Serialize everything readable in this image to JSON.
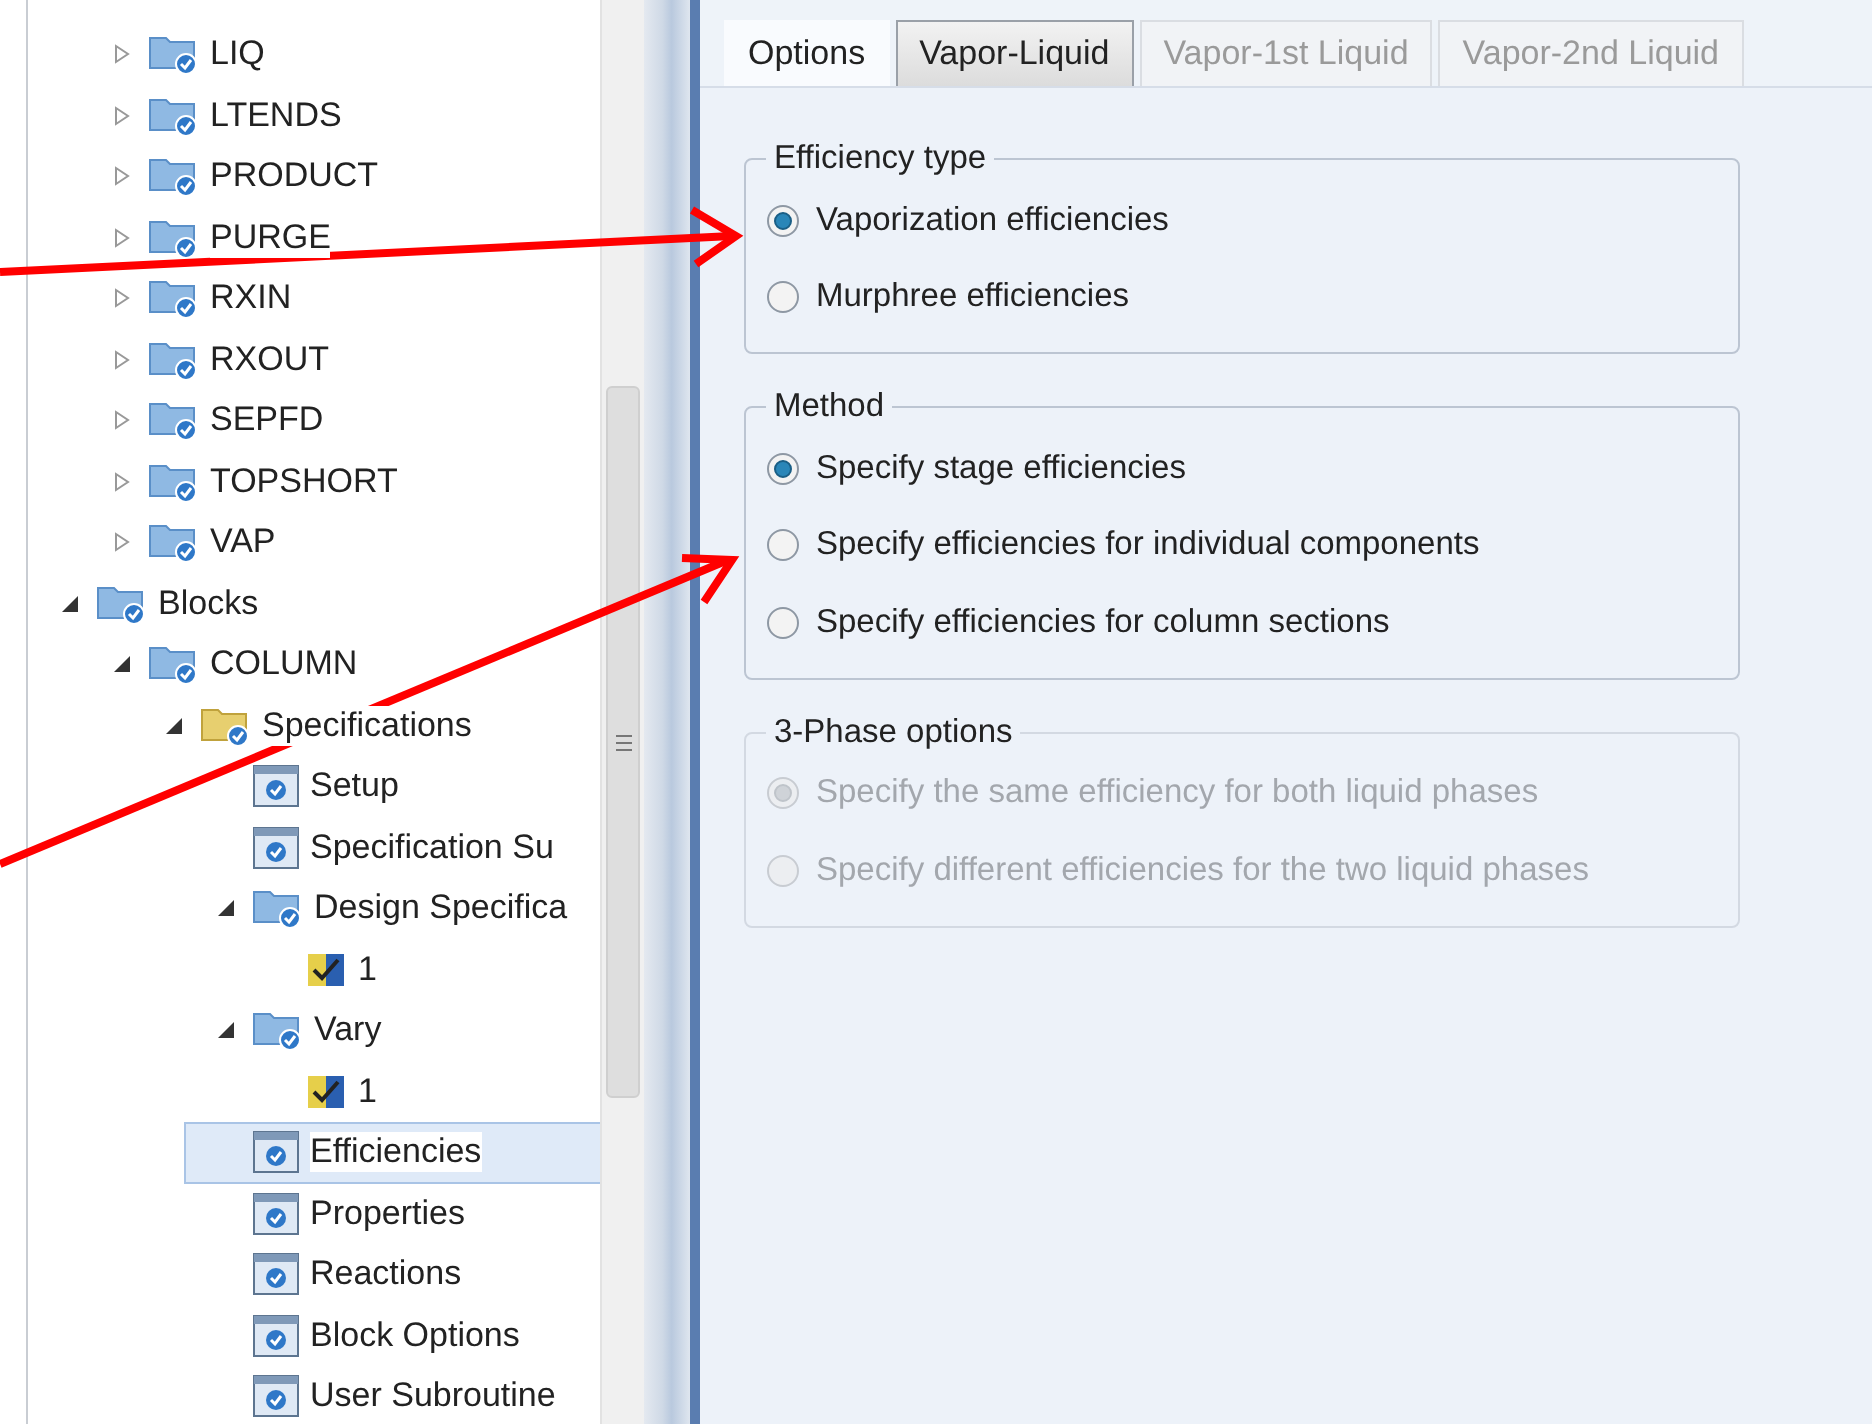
{
  "tree": {
    "items_of_hidden_parent": [
      {
        "label": "LIQ",
        "kind": "folder",
        "expanded": false,
        "selected": false
      },
      {
        "label": "LTENDS",
        "kind": "folder",
        "expanded": false,
        "selected": false
      },
      {
        "label": "PRODUCT",
        "kind": "folder",
        "expanded": false,
        "selected": false
      },
      {
        "label": "PURGE",
        "kind": "folder",
        "expanded": false,
        "selected": false
      },
      {
        "label": "RXIN",
        "kind": "folder",
        "expanded": false,
        "selected": false
      },
      {
        "label": "RXOUT",
        "kind": "folder",
        "expanded": false,
        "selected": false
      },
      {
        "label": "SEPFD",
        "kind": "folder",
        "expanded": false,
        "selected": false
      },
      {
        "label": "TOPSHORT",
        "kind": "folder",
        "expanded": false,
        "selected": false
      },
      {
        "label": "VAP",
        "kind": "folder",
        "expanded": false,
        "selected": false
      }
    ],
    "items": [
      {
        "label": "Blocks",
        "kind": "folder",
        "expanded": true,
        "selected": false,
        "children": [
          {
            "label": "COLUMN",
            "kind": "folder",
            "expanded": true,
            "selected": false,
            "children": [
              {
                "label": "Specifications",
                "kind": "subfolder",
                "expanded": true,
                "selected": false,
                "children": [
                  {
                    "label": "Setup",
                    "kind": "form",
                    "selected": false
                  },
                  {
                    "label": "Specification Su",
                    "kind": "form",
                    "selected": false
                  },
                  {
                    "label": "Design Specifica",
                    "kind": "folder",
                    "expanded": true,
                    "selected": false,
                    "children": [
                      {
                        "label": "1",
                        "kind": "result",
                        "selected": false
                      }
                    ]
                  },
                  {
                    "label": "Vary",
                    "kind": "folder",
                    "expanded": true,
                    "selected": false,
                    "children": [
                      {
                        "label": "1",
                        "kind": "result",
                        "selected": false
                      }
                    ]
                  },
                  {
                    "label": "Efficiencies",
                    "kind": "form",
                    "selected": true
                  },
                  {
                    "label": "Properties",
                    "kind": "form",
                    "selected": false
                  },
                  {
                    "label": "Reactions",
                    "kind": "form",
                    "selected": false
                  },
                  {
                    "label": "Block Options",
                    "kind": "form",
                    "selected": false
                  },
                  {
                    "label": "User Subroutine",
                    "kind": "form",
                    "selected": false
                  }
                ]
              }
            ]
          }
        ]
      }
    ]
  },
  "tabs": [
    {
      "label": "Options",
      "selected": true,
      "disabled": false
    },
    {
      "label": "Vapor-Liquid",
      "selected": false,
      "disabled": false
    },
    {
      "label": "Vapor-1st Liquid",
      "selected": false,
      "disabled": true
    },
    {
      "label": "Vapor-2nd Liquid",
      "selected": false,
      "disabled": true
    }
  ],
  "groups": [
    {
      "title": "Efficiency type",
      "disabled": false,
      "options": [
        {
          "label": "Vaporization efficiencies",
          "selected": true
        },
        {
          "label": "Murphree efficiencies",
          "selected": false
        }
      ]
    },
    {
      "title": "Method",
      "disabled": false,
      "options": [
        {
          "label": "Specify stage efficiencies",
          "selected": true
        },
        {
          "label": "Specify efficiencies for individual components",
          "selected": false
        },
        {
          "label": "Specify efficiencies for column sections",
          "selected": false
        }
      ]
    },
    {
      "title": "3-Phase options",
      "disabled": true,
      "options": [
        {
          "label": "Specify the same efficiency for both liquid phases",
          "selected": true
        },
        {
          "label": "Specify different efficiencies for the two liquid phases",
          "selected": false
        }
      ]
    }
  ]
}
